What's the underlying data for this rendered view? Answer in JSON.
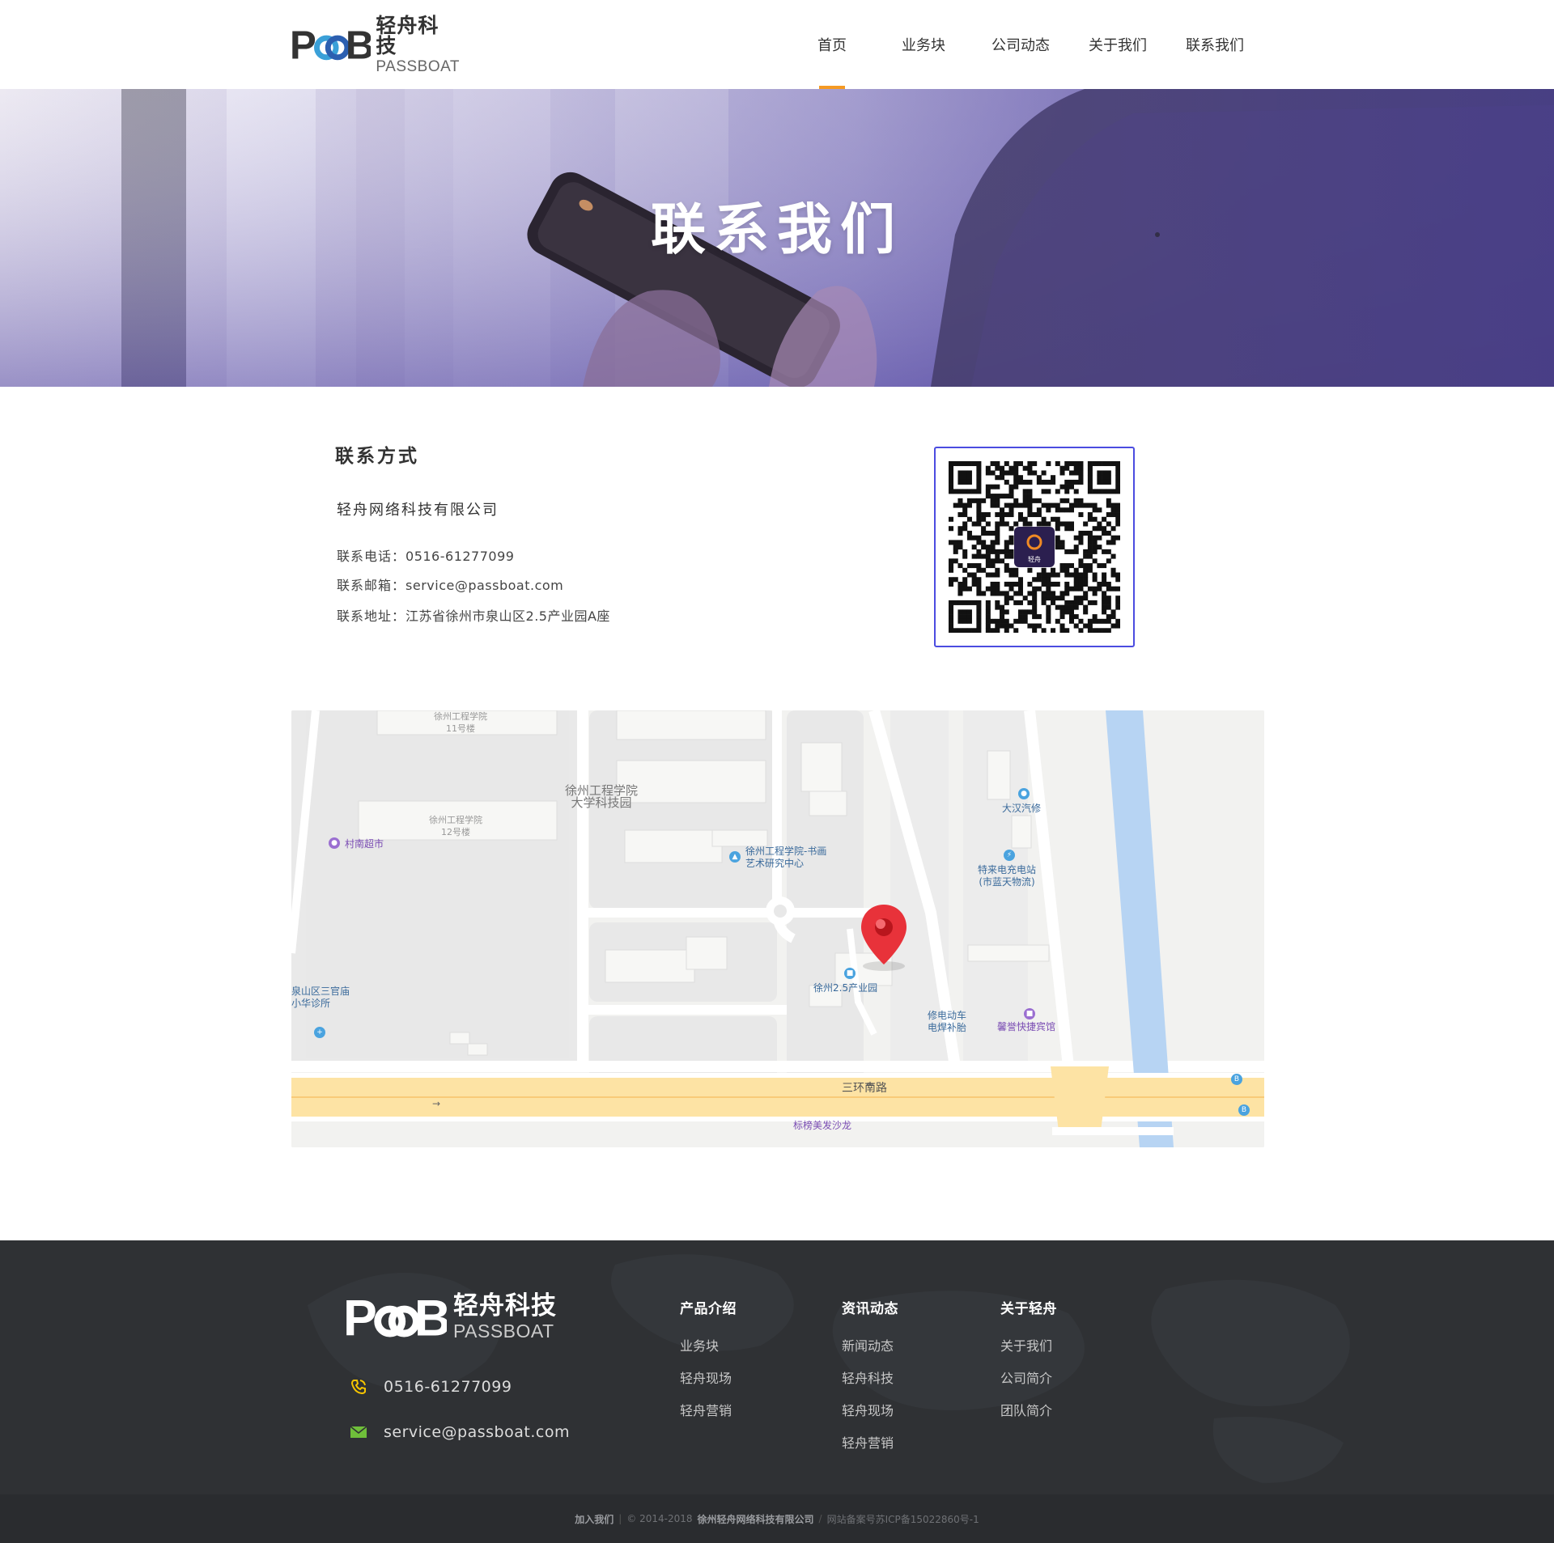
{
  "brand": {
    "mark": "P&B",
    "name_cn": "轻舟科技",
    "name_en": "PASSBOAT"
  },
  "nav": {
    "items": [
      {
        "label": "首页",
        "active": true
      },
      {
        "label": "业务块",
        "active": false
      },
      {
        "label": "公司动态",
        "active": false
      },
      {
        "label": "关于我们",
        "active": false
      },
      {
        "label": "联系我们",
        "active": false
      }
    ],
    "accent_color": "#f59a23"
  },
  "banner": {
    "title": "联系我们"
  },
  "contact": {
    "title": "联系方式",
    "company": "轻舟网络科技有限公司",
    "phone_label": "联系电话：",
    "phone": "0516-61277099",
    "email_label": "联系邮箱：",
    "email": "service@passboat.com",
    "address_label": "联系地址：",
    "address": "江苏省徐州市泉山区2.5产业园A座",
    "qr_center_text": "轻舟",
    "qr_border_color": "#4b4ce0"
  },
  "map": {
    "labels": {
      "bldg11_a": "徐州工程学院",
      "bldg11_b": "11号楼",
      "park_a": "徐州工程学院",
      "park_b": "大学科技园",
      "bldg12_a": "徐州工程学院",
      "bldg12_b": "12号楼",
      "market": "村南超市",
      "art_a": "徐州工程学院-书画",
      "art_b": "艺术研究中心",
      "dahan": "大汉汽修",
      "charge_a": "特来电充电站",
      "charge_b": "(市蓝天物流)",
      "clinic_a": "泉山区三官庙",
      "clinic_b": "小华诊所",
      "industrial": "徐州2.5产业园",
      "repair_a": "修电动车",
      "repair_b": "电焊补胎",
      "hotel": "馨誉快捷宾馆",
      "road": "三环南路",
      "salon": "标榜美发沙龙"
    },
    "colors": {
      "road": "#fde3a4",
      "river": "#b7d4f3",
      "marker": "#e8323a"
    }
  },
  "footer": {
    "phone": "0516-61277099",
    "email": "service@passboat.com",
    "columns": [
      {
        "title": "产品介绍",
        "links": [
          "业务块",
          "轻舟现场",
          "轻舟营销"
        ]
      },
      {
        "title": "资讯动态",
        "links": [
          "新闻动态",
          "轻舟科技",
          "轻舟现场",
          "轻舟营销"
        ]
      },
      {
        "title": "关于轻舟",
        "links": [
          "关于我们",
          "公司简介",
          "团队简介"
        ]
      }
    ],
    "copyright": {
      "join": "加入我们",
      "years": "© 2014-2018",
      "company": "徐州轻舟网络科技有限公司",
      "icp": "网站备案号苏ICP备15022860号-1"
    },
    "icon_colors": {
      "phone": "#f5c400",
      "email": "#6fbf3a"
    }
  }
}
